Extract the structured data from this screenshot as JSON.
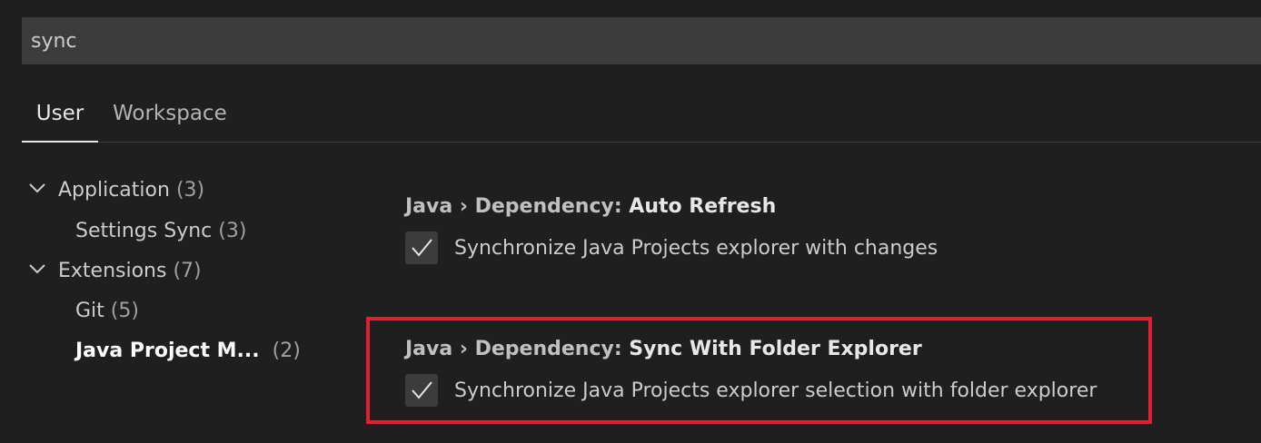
{
  "search": {
    "value": "sync"
  },
  "tabs": [
    {
      "label": "User"
    },
    {
      "label": "Workspace"
    }
  ],
  "toc": {
    "items": [
      {
        "name": "Application",
        "count": "(3)"
      },
      {
        "name": "Settings Sync",
        "count": "(3)"
      },
      {
        "name": "Extensions",
        "count": "(7)"
      },
      {
        "name": "Git",
        "count": "(5)"
      },
      {
        "name": "Java Project M...",
        "count": "(2)"
      }
    ]
  },
  "settings": [
    {
      "category": "Java › Dependency: ",
      "key": "Auto Refresh",
      "checked": true,
      "description": "Synchronize Java Projects explorer with changes"
    },
    {
      "category": "Java › Dependency: ",
      "key": "Sync With Folder Explorer",
      "checked": true,
      "description": "Synchronize Java Projects explorer selection with folder explorer"
    }
  ],
  "colors": {
    "background": "#1f1f1f",
    "input_background": "#3c3c3c",
    "highlight_border": "#e0202e"
  },
  "icons": {
    "chevron": "chevron-down-icon",
    "check": "check-icon"
  }
}
